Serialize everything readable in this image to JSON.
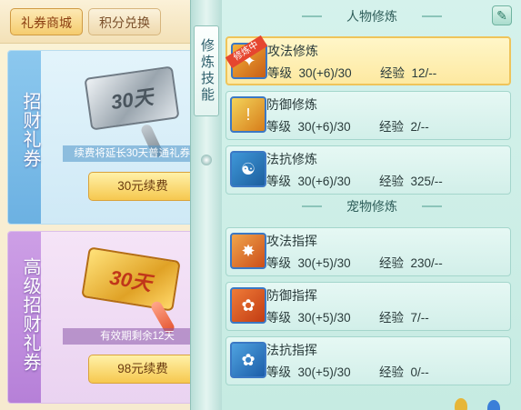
{
  "tabs": [
    {
      "label": "礼券商城",
      "active": true
    },
    {
      "label": "积分兑换",
      "active": false
    }
  ],
  "cards": [
    {
      "title": "招财礼券",
      "ticket": "30天",
      "note": "续费将延长30天普通礼券权",
      "button": "30元续费"
    },
    {
      "title": "高级招财礼券",
      "ticket": "30天",
      "note": "有效期剩余12天",
      "button": "98元续费"
    }
  ],
  "ribbon": {
    "label": "修炼技能"
  },
  "sections": {
    "character": "人物修炼",
    "pet": "宠物修炼"
  },
  "skills": [
    {
      "name": "攻法修炼",
      "level_label": "等级",
      "level": "30(+6)/30",
      "exp_label": "经验",
      "exp": "12/--",
      "selected": true,
      "badge": "修炼中",
      "icon": "attack-icon"
    },
    {
      "name": "防御修炼",
      "level_label": "等级",
      "level": "30(+6)/30",
      "exp_label": "经验",
      "exp": "2/--",
      "icon": "defense-icon"
    },
    {
      "name": "法抗修炼",
      "level_label": "等级",
      "level": "30(+6)/30",
      "exp_label": "经验",
      "exp": "325/--",
      "icon": "resist-icon"
    },
    {
      "name": "攻法指挥",
      "level_label": "等级",
      "level": "30(+5)/30",
      "exp_label": "经验",
      "exp": "230/--",
      "icon": "pet-attack-icon"
    },
    {
      "name": "防御指挥",
      "level_label": "等级",
      "level": "30(+5)/30",
      "exp_label": "经验",
      "exp": "7/--",
      "icon": "pet-defense-icon"
    },
    {
      "name": "法抗指挥",
      "level_label": "等级",
      "level": "30(+5)/30",
      "exp_label": "经验",
      "exp": "0/--",
      "icon": "pet-resist-icon"
    }
  ],
  "colors": {
    "accent": "#f5cc6e",
    "selected_bg": "#fde9a1",
    "badge": "#e6462f"
  }
}
